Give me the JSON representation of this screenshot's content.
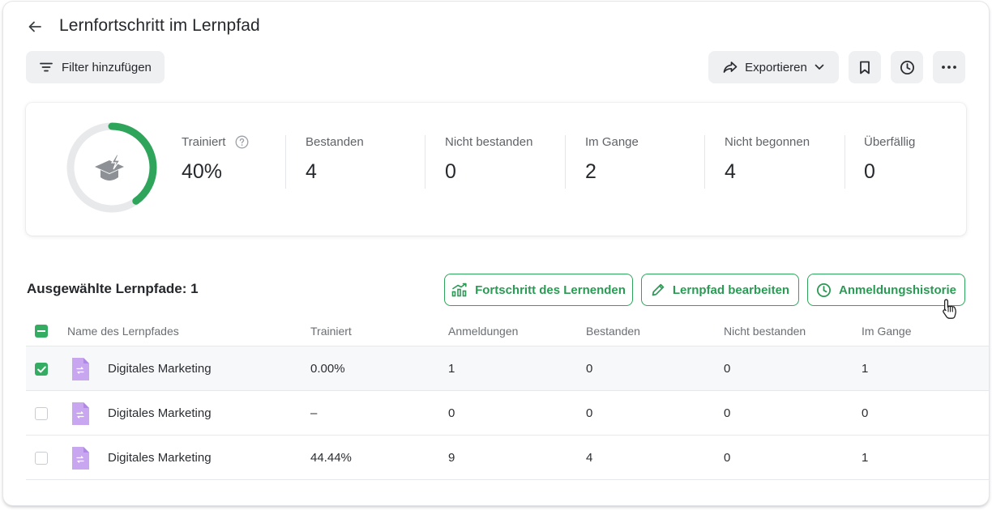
{
  "header": {
    "title": "Lernfortschritt im Lernpfad",
    "filter_label": "Filter hinzufügen",
    "export_label": "Exportieren"
  },
  "stats": {
    "progress_fraction": 0.4,
    "items": [
      {
        "label": "Trainiert",
        "value": "40%"
      },
      {
        "label": "Bestanden",
        "value": "4"
      },
      {
        "label": "Nicht bestanden",
        "value": "0"
      },
      {
        "label": "Im Gange",
        "value": "2"
      },
      {
        "label": "Nicht begonnen",
        "value": "4"
      },
      {
        "label": "Überfällig",
        "value": "0"
      }
    ]
  },
  "section": {
    "title": "Ausgewählte Lernpfade: 1",
    "buttons": {
      "progress": "Fortschritt des Lernenden",
      "edit": "Lernpfad bearbeiten",
      "history": "Anmeldungshistorie"
    }
  },
  "table": {
    "columns": [
      "Name des Lernpfades",
      "Trainiert",
      "Anmeldungen",
      "Bestanden",
      "Nicht bestanden",
      "Im Gange"
    ],
    "rows": [
      {
        "name": "Digitales Marketing",
        "trained": "0.00%",
        "enrollments": "1",
        "passed": "0",
        "failed": "0",
        "in_progress": "1",
        "checked": true
      },
      {
        "name": "Digitales Marketing",
        "trained": "–",
        "enrollments": "0",
        "passed": "0",
        "failed": "0",
        "in_progress": "0",
        "checked": false
      },
      {
        "name": "Digitales Marketing",
        "trained": "44.44%",
        "enrollments": "9",
        "passed": "4",
        "failed": "0",
        "in_progress": "1",
        "checked": false
      }
    ]
  },
  "colors": {
    "accent": "#2fa55b",
    "donut_track": "#e8e9eb",
    "file_icon": "#c9a6f0",
    "button_bg": "#eff0f2"
  },
  "icons": {
    "back": "arrow-left-icon",
    "filter": "filter-lines-icon",
    "export": "share-arrow-icon",
    "bookmark": "bookmark-icon",
    "history": "clock-icon",
    "more": "more-dots-icon",
    "course": "graduation-cap-icon",
    "file": "learning-path-file-icon"
  }
}
